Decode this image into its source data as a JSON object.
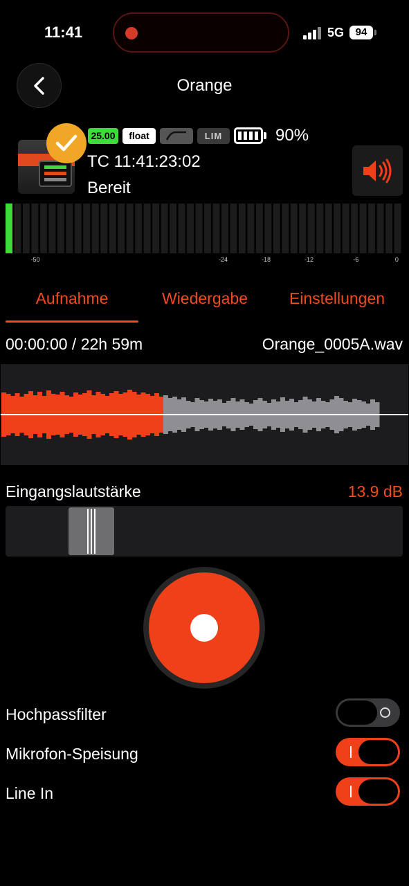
{
  "status_bar": {
    "time": "11:41",
    "network": "5G",
    "battery": "94"
  },
  "header": {
    "title": "Orange",
    "back_icon": "chevron-left-icon"
  },
  "device": {
    "badges": {
      "fps": "25.00",
      "format": "float",
      "limiter": "LIM"
    },
    "battery_percent": "90%",
    "timecode": "TC 11:41:23:02",
    "state": "Bereit",
    "colors": {
      "fps_badge": "#3ddc3a",
      "accent": "#f24b1f",
      "ready_badge": "#f0a727"
    }
  },
  "meter": {
    "level_segments_lit": 1,
    "total_segments": 46,
    "scale": [
      "-50",
      "-24",
      "-18",
      "-12",
      "-6",
      "0"
    ]
  },
  "tabs": [
    {
      "label": "Aufnahme",
      "active": true
    },
    {
      "label": "Wiedergabe",
      "active": false
    },
    {
      "label": "Einstellungen",
      "active": false
    }
  ],
  "recording": {
    "time": "00:00:00 / 22h 59m",
    "filename": "Orange_0005A.wav"
  },
  "gain": {
    "label": "Eingangslautstärke",
    "value": "13.9 dB",
    "slider_fraction": 0.18
  },
  "toggles": [
    {
      "label": "Hochpassfilter",
      "on": false
    },
    {
      "label": "Mikrofon-Speisung",
      "on": true
    },
    {
      "label": "Line In",
      "on": true
    }
  ]
}
